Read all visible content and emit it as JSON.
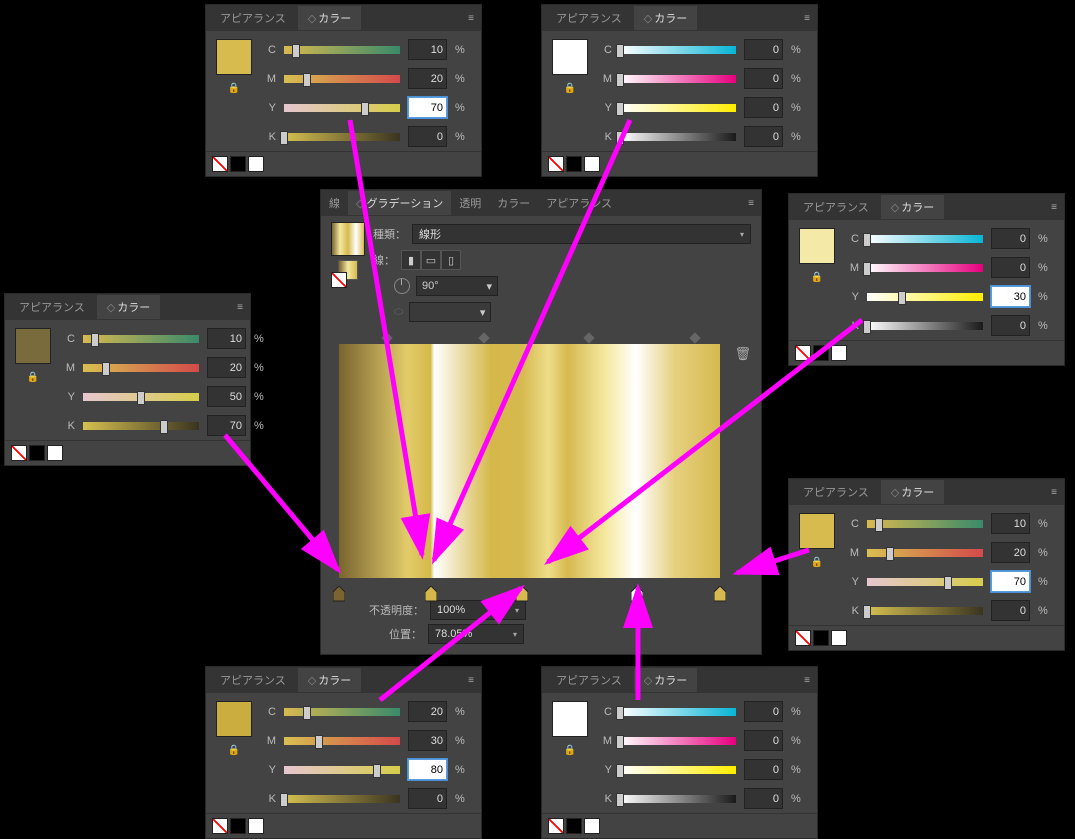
{
  "labels": {
    "appearance": "アピアランス",
    "color": "カラー",
    "stroke_tab": "線",
    "gradient_tab": "グラデーション",
    "transparency_tab": "透明",
    "type_label": "種類：",
    "type_linear": "線形",
    "stroke_seg_label": "線：",
    "angle_value": "90°",
    "opacity_label": "不透明度：",
    "opacity_value": "100%",
    "location_label": "位置：",
    "location_value": "78.05%",
    "percent": "%",
    "ch_c": "C",
    "ch_m": "M",
    "ch_y": "Y",
    "ch_k": "K"
  },
  "color_panels": {
    "top_left": {
      "swatch": "#d7bb4f",
      "C": "10",
      "M": "20",
      "Y": "70",
      "K": "0",
      "highlight": "Y",
      "bar_variant": "tinted"
    },
    "top_right": {
      "swatch": "#ffffff",
      "C": "0",
      "M": "0",
      "Y": "0",
      "K": "0",
      "highlight": null,
      "bar_variant": "pure"
    },
    "mid_left": {
      "swatch": "#796b3b",
      "C": "10",
      "M": "20",
      "Y": "50",
      "K": "70",
      "highlight": null,
      "bar_variant": "tinted"
    },
    "mid_right_upper": {
      "swatch": "#f4e9a6",
      "C": "0",
      "M": "0",
      "Y": "30",
      "K": "0",
      "highlight": "Y",
      "bar_variant": "pure"
    },
    "mid_right_lower": {
      "swatch": "#d7bb4f",
      "C": "10",
      "M": "20",
      "Y": "70",
      "K": "0",
      "highlight": "Y",
      "bar_variant": "tinted"
    },
    "bottom_left": {
      "swatch": "#cbac3e",
      "C": "20",
      "M": "30",
      "Y": "80",
      "K": "0",
      "highlight": "Y",
      "bar_variant": "tinted"
    },
    "bottom_right": {
      "swatch": "#ffffff",
      "C": "0",
      "M": "0",
      "Y": "0",
      "K": "0",
      "highlight": null,
      "bar_variant": "pure"
    }
  },
  "gradient": {
    "stops": [
      {
        "pos": 0,
        "color": "#7a6430"
      },
      {
        "pos": 24,
        "color": "#d5b849"
      },
      {
        "pos": 48,
        "color": "#d6b94f"
      },
      {
        "pos": 78,
        "color": "#ffffff"
      },
      {
        "pos": 100,
        "color": "#d6b94f"
      }
    ],
    "midpoints": [
      12,
      36,
      62,
      88
    ]
  },
  "arrows": [
    {
      "from": [
        350,
        120
      ],
      "to": [
        422,
        555
      ]
    },
    {
      "from": [
        630,
        120
      ],
      "to": [
        434,
        560
      ]
    },
    {
      "from": [
        225,
        435
      ],
      "to": [
        338,
        570
      ]
    },
    {
      "from": [
        862,
        320
      ],
      "to": [
        548,
        562
      ]
    },
    {
      "from": [
        809,
        550
      ],
      "to": [
        737,
        573
      ]
    },
    {
      "from": [
        380,
        700
      ],
      "to": [
        521,
        588
      ]
    },
    {
      "from": [
        638,
        700
      ],
      "to": [
        638,
        588
      ]
    }
  ]
}
